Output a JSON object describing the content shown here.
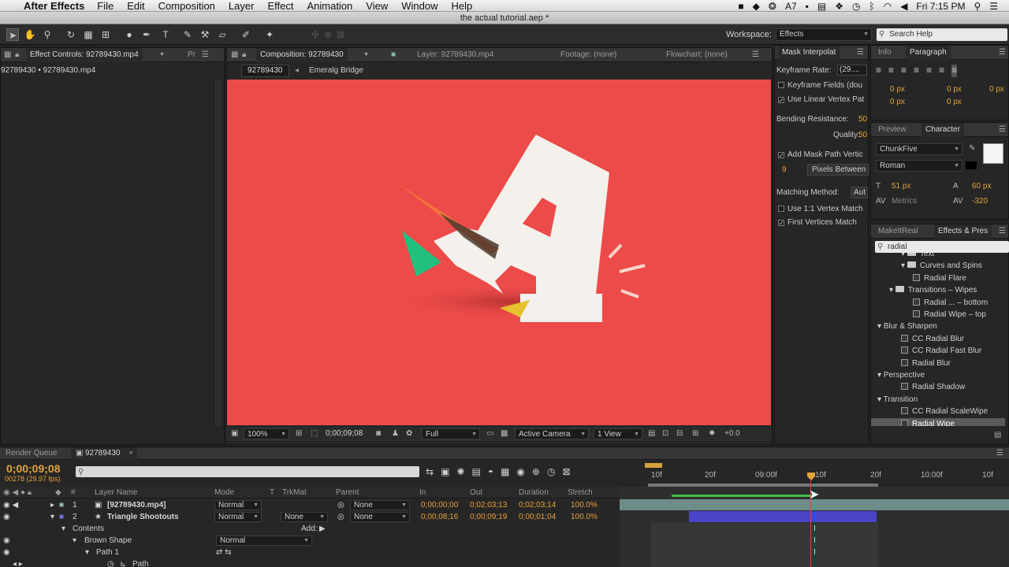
{
  "menubar": {
    "app_name": "After Effects",
    "items": [
      "File",
      "Edit",
      "Composition",
      "Layer",
      "Effect",
      "Animation",
      "View",
      "Window",
      "Help"
    ],
    "tray_badge": "7",
    "clock": "Fri 7:15 PM"
  },
  "window": {
    "title": "the actual tutorial.aep *"
  },
  "toolbar": {
    "workspace_label": "Workspace:",
    "workspace_value": "Effects",
    "search_placeholder": "Search Help"
  },
  "effect_controls": {
    "tab_label": "Effect Controls: 92789430.mp4",
    "tab2_label": "Pr",
    "subtitle": "92789430 • 92789430.mp4"
  },
  "composition": {
    "tab_label": "Composition: 92789430",
    "layer_tab": "Layer: 92789430.mp4",
    "footage_tab": "Footage: (none)",
    "flowchart_tab": "Flowchart: (none)",
    "breadcrumb_comp": "92789430",
    "breadcrumb_sep": "◂",
    "breadcrumb_item": "Emeralg Bridge",
    "zoom": "100%",
    "timecode": "0;00;09;08",
    "resolution": "Full",
    "camera": "Active Camera",
    "views": "1 View",
    "exposure": "+0.0"
  },
  "mask_panel": {
    "tab_label": "Mask Interpolat",
    "keyframe_rate_label": "Keyframe Rate:",
    "keyframe_rate_value": "(29....",
    "keyframe_fields": "Keyframe Fields (dou",
    "linear_vertex": "Use Linear Vertex Pat",
    "bending_label": "Bending Resistance:",
    "bending_value": "50",
    "quality_label": "Quality:",
    "quality_value": "50",
    "add_vertices": "Add Mask Path Vertic",
    "vertices_value": "9",
    "vertices_unit": "Pixels Between",
    "matching_label": "Matching Method:",
    "matching_value": "Aut",
    "vertex_match": "Use 1:1 Vertex Match",
    "first_vertices": "First Vertices Match"
  },
  "paragraph": {
    "tab_info": "Info",
    "tab_paragraph": "Paragraph",
    "values": [
      "0 px",
      "0 px",
      "0 px",
      "0 px",
      "0 px"
    ]
  },
  "character": {
    "tab_preview": "Preview",
    "tab_character": "Character",
    "font": "ChunkFive",
    "style": "Roman",
    "size": "51 px",
    "leading": "60 px",
    "kerning": "Metrics",
    "tracking": "-320"
  },
  "effects_presets": {
    "tab_makeit": "MakeItReal",
    "tab_effects": "Effects & Pres",
    "search_value": "radial",
    "items": [
      {
        "label": "Text",
        "indent": 2,
        "kind": "folder"
      },
      {
        "label": "Curves and Spins",
        "indent": 2,
        "kind": "folder"
      },
      {
        "label": "Radial Flare",
        "indent": 3,
        "kind": "fx"
      },
      {
        "label": "Transitions – Wipes",
        "indent": 1,
        "kind": "folder"
      },
      {
        "label": "Radial ... – bottom",
        "indent": 3,
        "kind": "fx"
      },
      {
        "label": "Radial Wipe – top",
        "indent": 3,
        "kind": "fx"
      },
      {
        "label": "Blur & Sharpen",
        "indent": 0,
        "kind": "cat"
      },
      {
        "label": "CC Radial Blur",
        "indent": 2,
        "kind": "fx"
      },
      {
        "label": "CC Radial Fast Blur",
        "indent": 2,
        "kind": "fx"
      },
      {
        "label": "Radial Blur",
        "indent": 2,
        "kind": "fx"
      },
      {
        "label": "Perspective",
        "indent": 0,
        "kind": "cat"
      },
      {
        "label": "Radial Shadow",
        "indent": 2,
        "kind": "fx"
      },
      {
        "label": "Transition",
        "indent": 0,
        "kind": "cat"
      },
      {
        "label": "CC Radial ScaleWipe",
        "indent": 2,
        "kind": "fx"
      },
      {
        "label": "Radial Wipe",
        "indent": 2,
        "kind": "fx",
        "selected": true
      }
    ]
  },
  "timeline": {
    "tab_render": "Render Queue",
    "tab_comp": "92789430",
    "timecode": "0;00;09;08",
    "frames": "00278 (29.97 fps)",
    "headers": {
      "num": "#",
      "name": "Layer Name",
      "mode": "Mode",
      "t": "T",
      "trkmat": "TrkMat",
      "parent": "Parent",
      "in": "In",
      "out": "Out",
      "duration": "Duration",
      "stretch": "Stretch"
    },
    "layers": [
      {
        "num": "1",
        "name": "[92789430.mp4]",
        "mode": "Normal",
        "trkmat": "",
        "parent": "None",
        "in": "0;00;00;00",
        "out": "0;02;03;13",
        "duration": "0;02;03;14",
        "stretch": "100.0%"
      },
      {
        "num": "2",
        "name": "Triangle Shootouts",
        "mode": "Normal",
        "trkmat": "None",
        "parent": "None",
        "in": "0;00;08;16",
        "out": "0;00;09;19",
        "duration": "0;00;01;04",
        "stretch": "100.0%"
      }
    ],
    "contents_label": "Contents",
    "add_label": "Add:",
    "brown_shape": "Brown Shape",
    "brown_mode": "Normal",
    "path1": "Path 1",
    "path": "Path",
    "ruler": [
      "10f",
      "20f",
      "09:00f",
      "10f",
      "20f",
      "10:00f",
      "10f"
    ]
  },
  "colors": {
    "comp_bg": "#ec4b49",
    "accent_orange": "#e6a23c",
    "layer_bar_blue": "#4a45c8",
    "playhead": "#e6a23c"
  }
}
